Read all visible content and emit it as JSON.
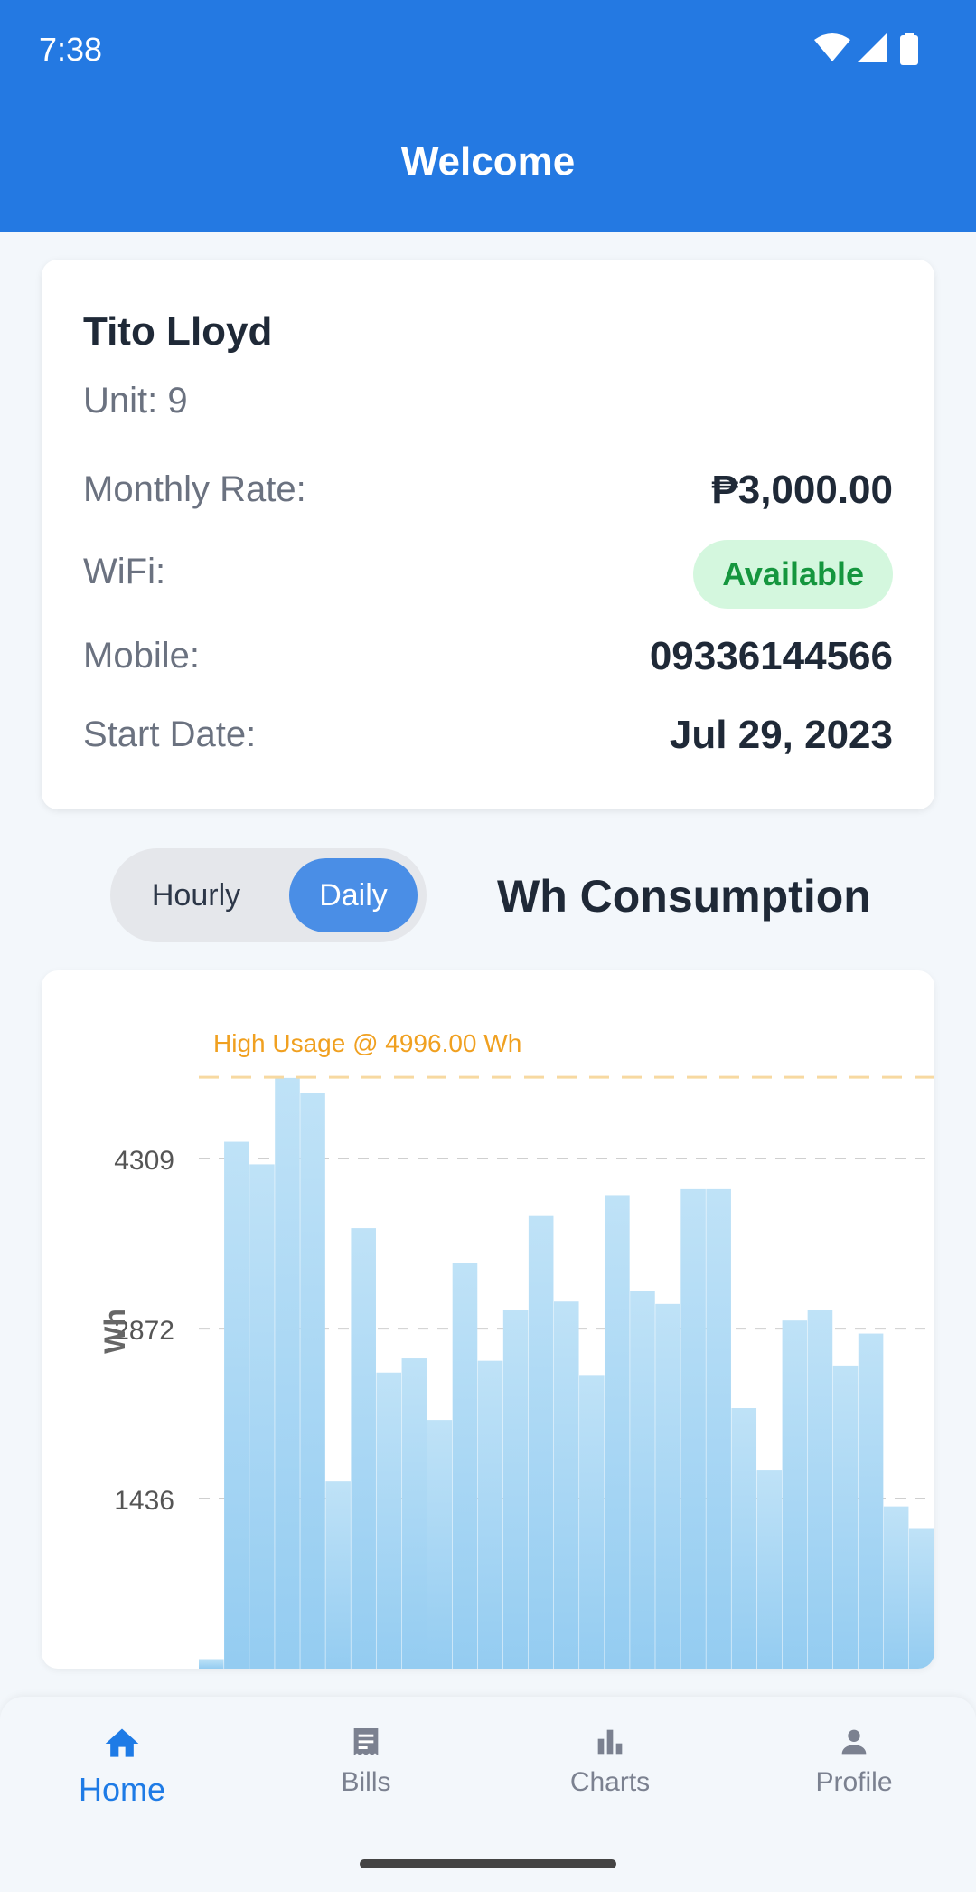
{
  "status_bar": {
    "time": "7:38",
    "icons": [
      "wifi-icon",
      "signal-icon",
      "battery-icon"
    ]
  },
  "app_bar": {
    "title": "Welcome"
  },
  "tenant": {
    "name": "Tito Lloyd",
    "unit": "Unit: 9",
    "monthly_rate_label": "Monthly Rate:",
    "monthly_rate_value": "₱3,000.00",
    "wifi_label": "WiFi:",
    "wifi_value": "Available",
    "mobile_label": "Mobile:",
    "mobile_value": "09336144566",
    "start_date_label": "Start Date:",
    "start_date_value": "Jul 29, 2023"
  },
  "consumption": {
    "toggle": {
      "options": [
        "Hourly",
        "Daily"
      ],
      "selected": "Daily"
    },
    "title": "Wh Consumption"
  },
  "chart_data": {
    "type": "bar",
    "ylabel": "Wh",
    "yticks": [
      1436,
      2872,
      4309
    ],
    "ylim": [
      0,
      5000
    ],
    "threshold": {
      "label": "High Usage @ 4996.00 Wh",
      "value": 4996
    },
    "grid": true,
    "values": [
      80,
      4450,
      4260,
      4990,
      4860,
      1580,
      3720,
      2500,
      2620,
      2100,
      3430,
      2600,
      3030,
      3830,
      3100,
      2480,
      4000,
      3190,
      3080,
      4050,
      4050,
      2200,
      1680,
      2940,
      3030,
      2560,
      2830,
      1370,
      1180
    ],
    "color": "#9fd3f3"
  },
  "bottom_nav": {
    "items": [
      {
        "label": "Home",
        "icon": "home-icon",
        "active": true
      },
      {
        "label": "Bills",
        "icon": "bills-icon",
        "active": false
      },
      {
        "label": "Charts",
        "icon": "charts-icon",
        "active": false
      },
      {
        "label": "Profile",
        "icon": "profile-icon",
        "active": false
      }
    ]
  },
  "colors": {
    "primary": "#2479e2",
    "accent": "#4a8ee6",
    "success": "#15963e",
    "warning": "#f5a623"
  }
}
